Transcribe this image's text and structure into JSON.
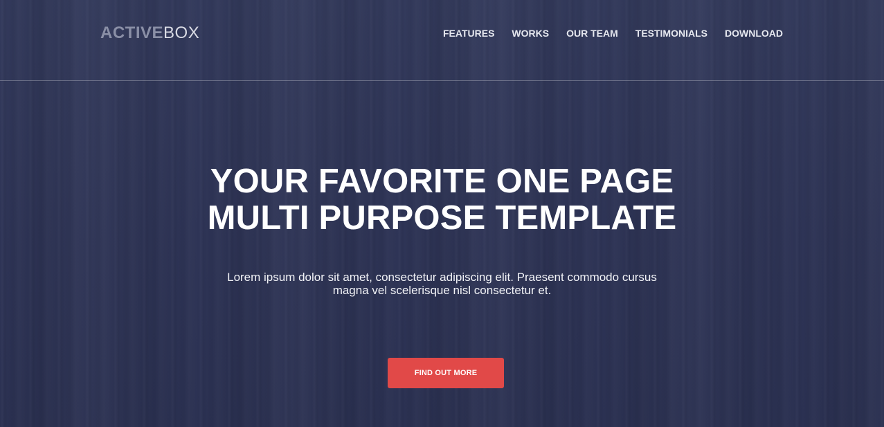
{
  "brand": {
    "logo_bold": "ACTIVE",
    "logo_light": "BOX"
  },
  "nav": {
    "items": [
      {
        "label": "FEATURES"
      },
      {
        "label": "WORKS"
      },
      {
        "label": "OUR TEAM"
      },
      {
        "label": "TESTIMONIALS"
      },
      {
        "label": "DOWNLOAD"
      }
    ]
  },
  "hero": {
    "title_line1": "YOUR FAVORITE ONE PAGE",
    "title_line2": "MULTI PURPOSE TEMPLATE",
    "subtitle_line1": "Lorem ipsum dolor sit amet, consectetur adipiscing elit. Praesent commodo cursus",
    "subtitle_line2": "magna vel scelerisque nisl consectetur et.",
    "cta_label": "FIND OUT MORE"
  },
  "colors": {
    "background": "#2f3556",
    "accent": "#e14948",
    "logo_bold": "#8a8fa6",
    "text": "#ffffff"
  }
}
